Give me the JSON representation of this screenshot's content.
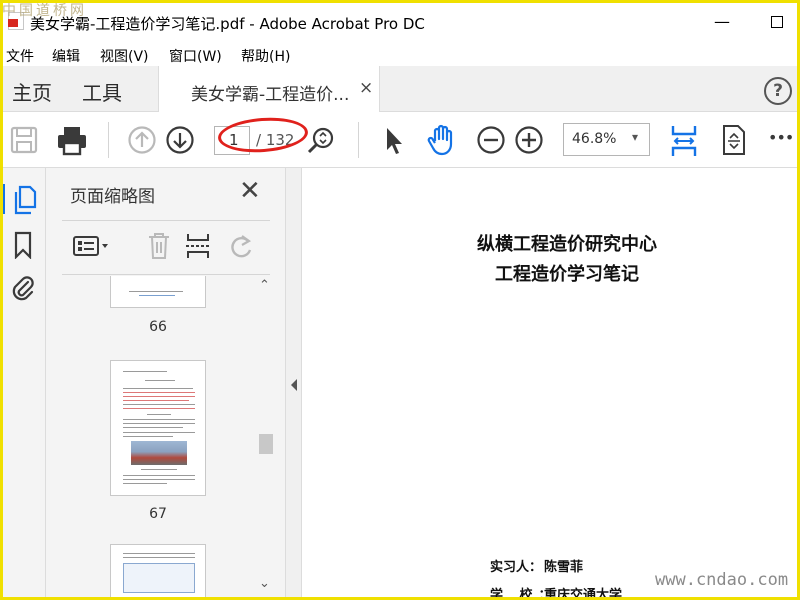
{
  "window": {
    "title": "美女学霸-工程造价学习笔记.pdf - Adobe Acrobat Pro DC",
    "minimize_glyph": "—",
    "watermark_top_left": "中国道桥网",
    "watermark_bottom_right": "www.cndao.com"
  },
  "menu": {
    "items": [
      "文件",
      "编辑",
      "视图(V)",
      "窗口(W)",
      "帮助(H)"
    ]
  },
  "tabs": {
    "home": "主页",
    "tools": "工具",
    "document": "美女学霸-工程造价...",
    "close_glyph": "×",
    "help_glyph": "?"
  },
  "toolbar": {
    "icons": [
      "save-icon",
      "print-icon",
      "page-up-icon",
      "page-down-icon",
      "find-zoom-icon",
      "select-cursor-icon",
      "hand-tool-icon",
      "zoom-out-icon",
      "zoom-in-icon",
      "fit-width-icon",
      "fullscreen-icon",
      "more-icon"
    ],
    "page_current": "1",
    "page_total": "/ 132",
    "zoom": "46.8%",
    "zoom_caret": "▾",
    "more_glyph": "•••",
    "accent_color": "#1473e6"
  },
  "thumbnails": {
    "title": "页面缩略图",
    "close_glyph": "✕",
    "pages": [
      "66",
      "67"
    ],
    "scroll_up_glyph": "⌃",
    "scroll_down_glyph": "⌄"
  },
  "document": {
    "title_line1": "纵横工程造价研究中心",
    "title_line2": "工程造价学习笔记",
    "intern_label": "实习人：",
    "intern_name": "陈雪菲",
    "school_label": "学 校：",
    "school_name": "重庆交通大学"
  },
  "annotation": {
    "highlight_color": "#e0211c"
  }
}
